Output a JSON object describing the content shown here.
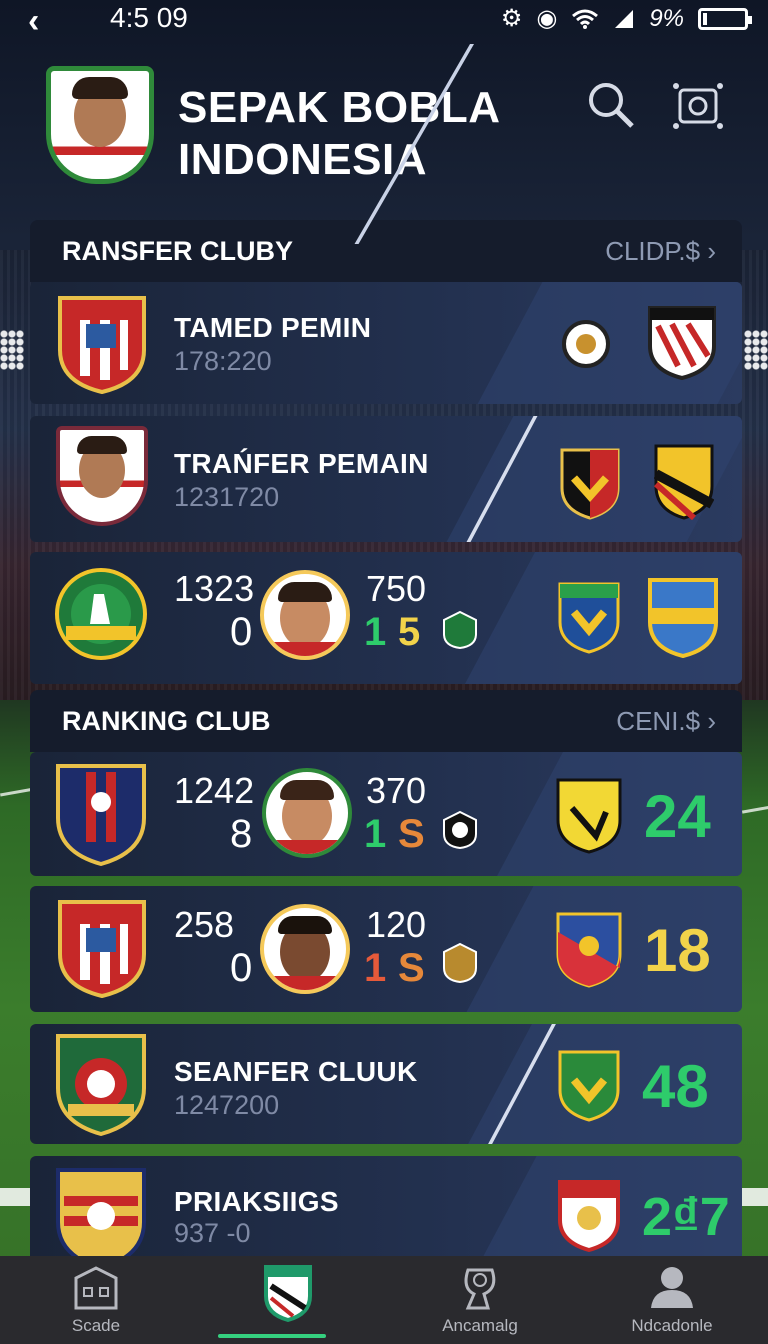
{
  "status": {
    "time": "4:5 09",
    "battery": "9%"
  },
  "header": {
    "title_line1": "SEPAK BOBLA",
    "title_line2": "INDONESIA"
  },
  "transfer_section": {
    "title": "RANSFER CLUBY",
    "more": "CLIDP.$"
  },
  "transfer_rows": [
    {
      "name": "TAMED PEMIN",
      "sub": "178:220"
    },
    {
      "name": "TRAŃFER PEMAIN",
      "sub": "1231720"
    },
    {
      "left_top": "1323",
      "left_bottom": "0",
      "right_top": "750",
      "right_bottom_a": "1",
      "right_bottom_b": "5"
    }
  ],
  "ranking_section": {
    "title": "RANKING CLUB",
    "more": "CENI.$"
  },
  "ranking_rows": [
    {
      "left_top": "1242",
      "left_bottom": "8",
      "right_top": "370",
      "right_bottom_a": "1",
      "right_bottom_b": "S",
      "score": "24"
    },
    {
      "left_top": "258",
      "left_bottom": "0",
      "right_top": "120",
      "right_bottom_a": "1",
      "right_bottom_b": "S",
      "score": "18"
    },
    {
      "name": "SEANFER CLUUK",
      "sub": "1247200",
      "score": "48"
    },
    {
      "name": "PRIAKSIIGS",
      "sub": "937 -0",
      "score": "2₫7"
    }
  ],
  "nav": [
    "Scade",
    "",
    "Ancamalg",
    "Ndcadonle"
  ],
  "colors": {
    "accent_green": "#35d07f",
    "score_green": "#2ecc6b",
    "score_yellow": "#f2d34a",
    "orange": "#e6883a"
  }
}
